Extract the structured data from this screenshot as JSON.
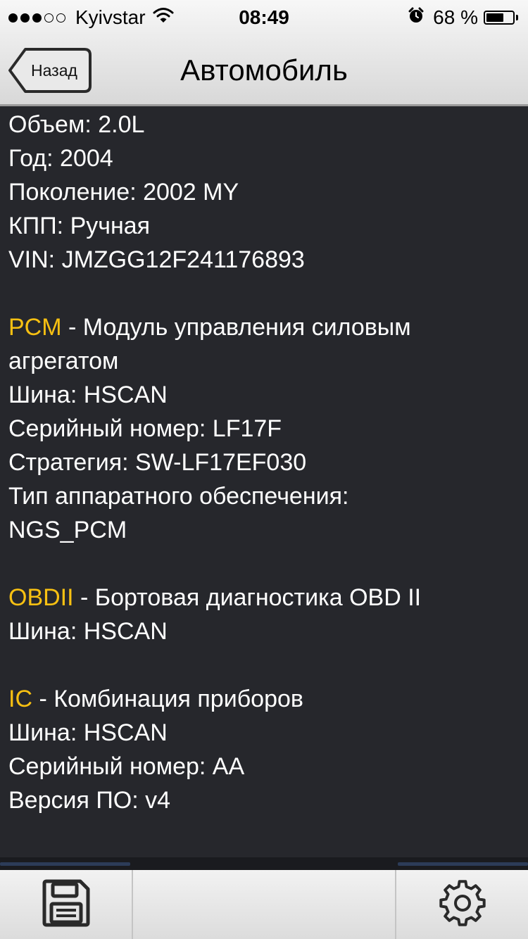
{
  "status_bar": {
    "carrier": "Kyivstar",
    "time": "08:49",
    "battery": "68 %",
    "battery_level": 0.68,
    "signal_bars_filled": 3,
    "signal_bars_total": 5,
    "icons": [
      "wifi-icon",
      "alarm-icon",
      "battery-icon"
    ]
  },
  "nav": {
    "back_label": "Назад",
    "title": "Автомобиль"
  },
  "vehicle": {
    "volume": "Объем: 2.0L",
    "year": "Год: 2004",
    "generation": "Поколение: 2002 MY",
    "gearbox": "КПП: Ручная",
    "vin": "VIN: JMZGG12F241176893"
  },
  "modules": [
    {
      "code": "PCM",
      "description": " - Модуль управления силовым",
      "description_cont": "агрегатом",
      "bus": "Шина: HSCAN",
      "serial": "Серийный номер: LF17F",
      "strategy": "Стратегия: SW-LF17EF030",
      "hardware_label": "Тип аппаратного обеспечения:",
      "hardware_value": "NGS_PCM"
    },
    {
      "code": "OBDII",
      "description": " - Бортовая диагностика OBD II",
      "bus": "Шина: HSCAN"
    },
    {
      "code": "IC",
      "description": " - Комбинация приборов",
      "bus": "Шина: HSCAN",
      "serial": "Серийный номер: AA",
      "version": "Версия ПО: v4"
    }
  ],
  "toolbar": {
    "icons": [
      "save-icon",
      "gear-icon"
    ]
  },
  "colors": {
    "background": "#26272c",
    "text": "#ffffff",
    "accent": "#f7c012",
    "bar": "#e6e6e6"
  }
}
